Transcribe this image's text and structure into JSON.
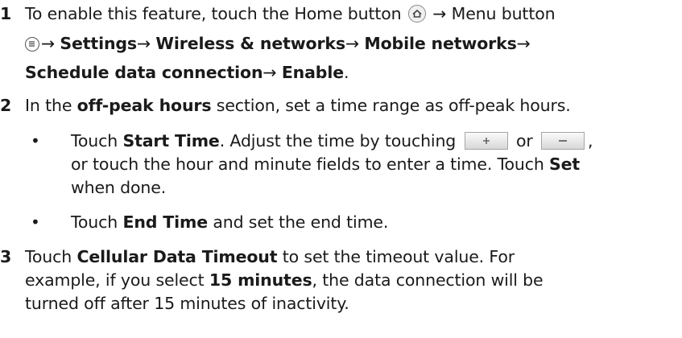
{
  "steps": [
    {
      "number": "1",
      "lines": {
        "l1a": "To enable this feature, touch the Home button",
        "l1b": "Menu button",
        "l2": {
          "settings": "Settings",
          "wireless": "Wireless & networks",
          "mobile": "Mobile networks"
        },
        "l3": {
          "schedule": "Schedule data connection",
          "enable": "Enable",
          "end": "."
        }
      }
    },
    {
      "number": "2",
      "lines": {
        "pre": "In the ",
        "bold": "off-peak hours",
        "post": " section, set a time range as off-peak hours."
      },
      "bullets": [
        {
          "l1_pre": "Touch ",
          "l1_bold": "Start Time",
          "l1_mid": ". Adjust the time by touching",
          "l1_or": "or",
          "l1_end": ",",
          "l2_pre": "or touch the hour and minute fields to enter a time. Touch ",
          "l2_bold": "Set",
          "l3": "when done."
        },
        {
          "pre": "Touch ",
          "bold": "End Time",
          "post": " and set the end time."
        }
      ]
    },
    {
      "number": "3",
      "lines": {
        "l1_pre": "Touch ",
        "l1_bold": "Cellular Data Timeout",
        "l1_post": " to set the timeout value. For",
        "l2_pre": "example, if you select ",
        "l2_bold": "15 minutes",
        "l2_post": ", the data connection will be",
        "l3": "turned off after 15 minutes of inactivity."
      }
    }
  ],
  "glyphs": {
    "arrow": "→",
    "bullet": "•"
  },
  "icons": {
    "home": "home-icon",
    "menu": "menu-icon",
    "plus": "plus-button-icon",
    "minus": "minus-button-icon"
  }
}
